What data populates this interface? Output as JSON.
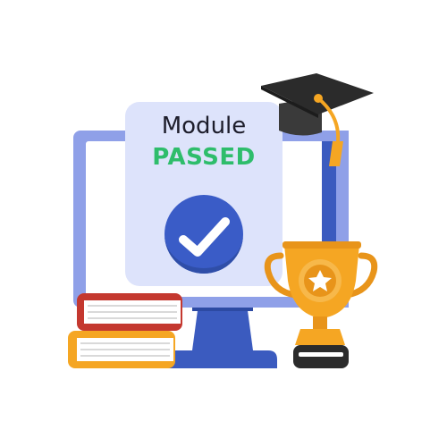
{
  "card": {
    "title": "Module",
    "status": "PASSED"
  },
  "colors": {
    "monitor_frame": "#8fa0e8",
    "monitor_screen": "#ffffff",
    "monitor_stand": "#3b5bbf",
    "card_background": "#dde3fb",
    "status_text": "#2ebd6b",
    "check_badge": "#3a5cc7",
    "graduation_cap": "#2b2b2b",
    "tassel": "#f5a623",
    "trophy": "#f5a623",
    "book_top": "#c4382f",
    "book_bottom": "#f5a623"
  },
  "icons": {
    "check_badge": "checkmark-badge-icon",
    "graduation_cap": "graduation-cap-icon",
    "trophy": "trophy-icon",
    "books": "book-stack-icon"
  }
}
